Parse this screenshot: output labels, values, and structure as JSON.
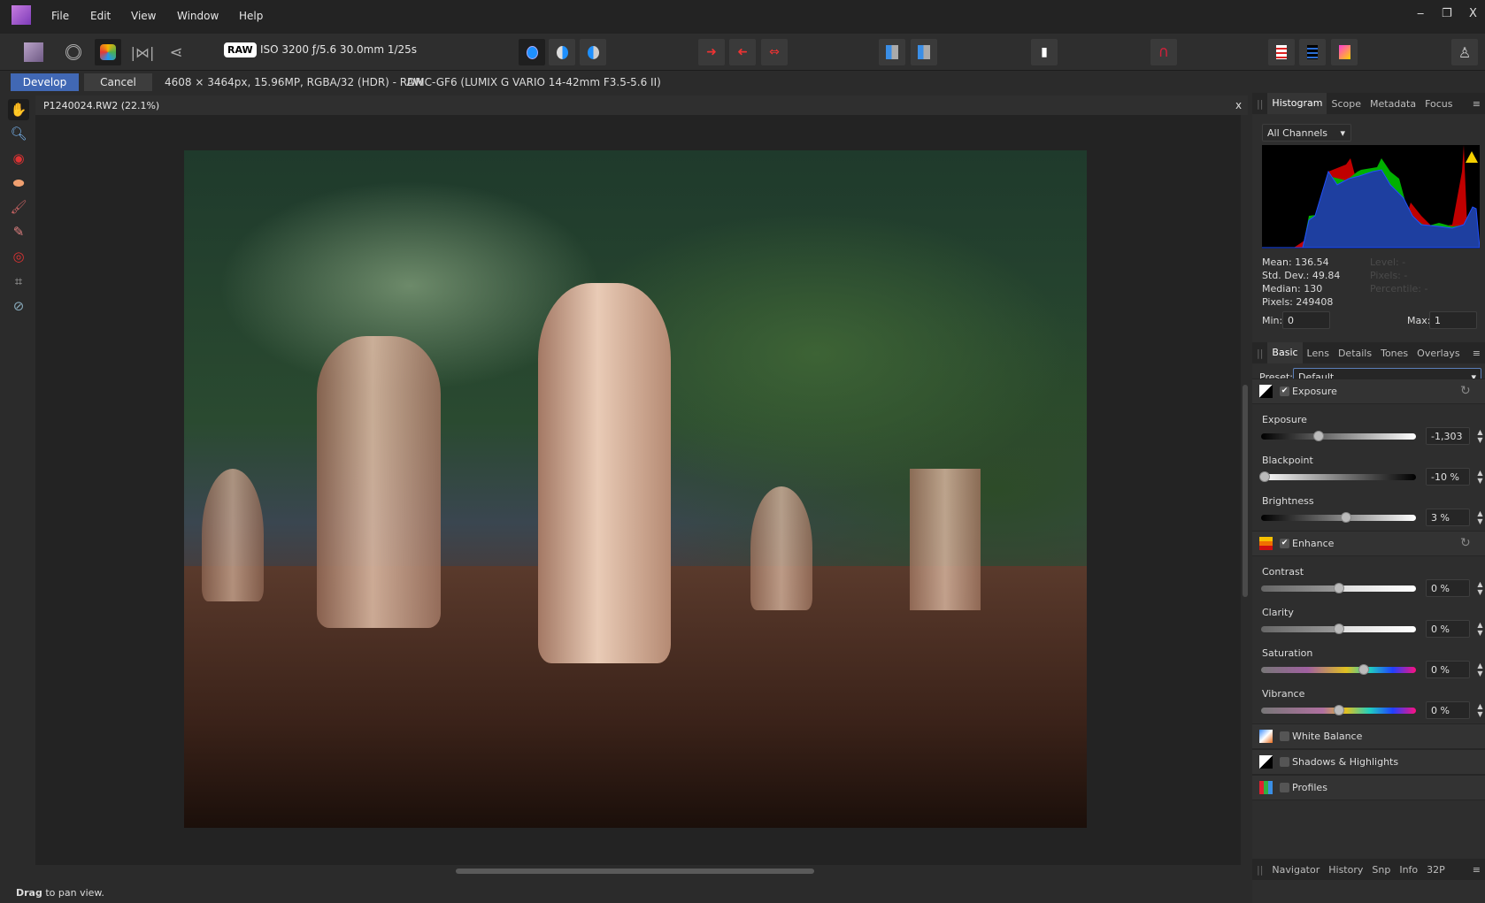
{
  "menu": {
    "items": [
      "File",
      "Edit",
      "View",
      "Window",
      "Help"
    ]
  },
  "window": {
    "minimize": "‒",
    "restore": "❐",
    "close": "X"
  },
  "toolbar": {
    "raw_badge": "RAW",
    "exif": "ISO 3200 ƒ/5.6 30.0mm 1/25s"
  },
  "context": {
    "develop": "Develop",
    "cancel": "Cancel",
    "image_info": "4608 × 3464px, 15.96MP, RGBA/32 (HDR) - RAW",
    "camera": "DMC-GF6 (LUMIX G VARIO 14-42mm F3.5-5.6 II)"
  },
  "document": {
    "tab": "P1240024.RW2 (22.1%)",
    "close": "x"
  },
  "status": {
    "bold": "Drag",
    "rest": " to pan view."
  },
  "histogram_panel": {
    "tabs": [
      "Histogram",
      "Scope",
      "Metadata",
      "Focus"
    ],
    "channel": "All Channels",
    "stats": {
      "mean": "Mean: 136.54",
      "std": "Std. Dev.: 49.84",
      "median": "Median: 130",
      "pixels": "Pixels: 249408"
    },
    "probe": {
      "level": "Level: -",
      "pixels": "Pixels: -",
      "percentile": "Percentile: -"
    },
    "min_label": "Min:",
    "min": "0",
    "max_label": "Max:",
    "max": "1",
    "colors": {
      "red": "#c00000",
      "green": "#00b000",
      "blue": "#1e3fa0"
    }
  },
  "develop_panel": {
    "tabs": [
      "Basic",
      "Lens",
      "Details",
      "Tones",
      "Overlays"
    ],
    "preset_label": "Preset:",
    "preset": "Default",
    "sections": [
      {
        "title": "Exposure",
        "checked": true,
        "sliders": [
          {
            "label": "Exposure",
            "value": "-1,303",
            "level": 0.37
          },
          {
            "label": "Blackpoint",
            "value": "-10 %",
            "level": 0.02
          },
          {
            "label": "Brightness",
            "value": "3 %",
            "level": 0.55
          }
        ]
      },
      {
        "title": "Enhance",
        "checked": true,
        "sliders": [
          {
            "label": "Contrast",
            "value": "0 %",
            "level": 0.5
          },
          {
            "label": "Clarity",
            "value": "0 %",
            "level": 0.5
          },
          {
            "label": "Saturation",
            "value": "0 %",
            "level": 0.66
          },
          {
            "label": "Vibrance",
            "value": "0 %",
            "level": 0.5
          }
        ]
      },
      {
        "title": "White Balance",
        "checked": false
      },
      {
        "title": "Shadows & Highlights",
        "checked": false
      },
      {
        "title": "Profiles",
        "checked": false
      }
    ]
  },
  "bottom_panel": {
    "tabs": [
      "Navigator",
      "History",
      "Snp",
      "Info",
      "32P"
    ]
  }
}
